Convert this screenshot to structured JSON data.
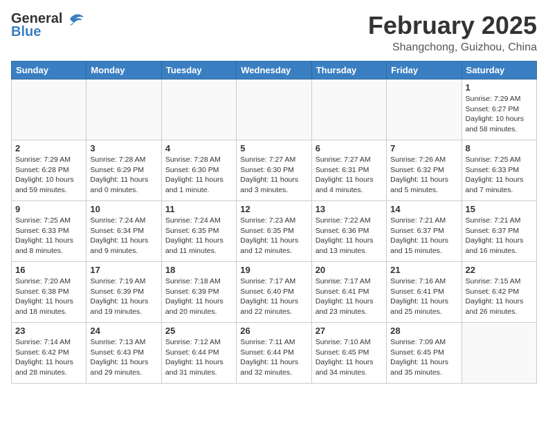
{
  "header": {
    "logo": {
      "general": "General",
      "blue": "Blue"
    },
    "title": "February 2025",
    "location": "Shangchong, Guizhou, China"
  },
  "calendar": {
    "days_of_week": [
      "Sunday",
      "Monday",
      "Tuesday",
      "Wednesday",
      "Thursday",
      "Friday",
      "Saturday"
    ],
    "weeks": [
      [
        {
          "day": "",
          "info": ""
        },
        {
          "day": "",
          "info": ""
        },
        {
          "day": "",
          "info": ""
        },
        {
          "day": "",
          "info": ""
        },
        {
          "day": "",
          "info": ""
        },
        {
          "day": "",
          "info": ""
        },
        {
          "day": "1",
          "info": "Sunrise: 7:29 AM\nSunset: 6:27 PM\nDaylight: 10 hours and 58 minutes."
        }
      ],
      [
        {
          "day": "2",
          "info": "Sunrise: 7:29 AM\nSunset: 6:28 PM\nDaylight: 10 hours and 59 minutes."
        },
        {
          "day": "3",
          "info": "Sunrise: 7:28 AM\nSunset: 6:29 PM\nDaylight: 11 hours and 0 minutes."
        },
        {
          "day": "4",
          "info": "Sunrise: 7:28 AM\nSunset: 6:30 PM\nDaylight: 11 hours and 1 minute."
        },
        {
          "day": "5",
          "info": "Sunrise: 7:27 AM\nSunset: 6:30 PM\nDaylight: 11 hours and 3 minutes."
        },
        {
          "day": "6",
          "info": "Sunrise: 7:27 AM\nSunset: 6:31 PM\nDaylight: 11 hours and 4 minutes."
        },
        {
          "day": "7",
          "info": "Sunrise: 7:26 AM\nSunset: 6:32 PM\nDaylight: 11 hours and 5 minutes."
        },
        {
          "day": "8",
          "info": "Sunrise: 7:25 AM\nSunset: 6:33 PM\nDaylight: 11 hours and 7 minutes."
        }
      ],
      [
        {
          "day": "9",
          "info": "Sunrise: 7:25 AM\nSunset: 6:33 PM\nDaylight: 11 hours and 8 minutes."
        },
        {
          "day": "10",
          "info": "Sunrise: 7:24 AM\nSunset: 6:34 PM\nDaylight: 11 hours and 9 minutes."
        },
        {
          "day": "11",
          "info": "Sunrise: 7:24 AM\nSunset: 6:35 PM\nDaylight: 11 hours and 11 minutes."
        },
        {
          "day": "12",
          "info": "Sunrise: 7:23 AM\nSunset: 6:35 PM\nDaylight: 11 hours and 12 minutes."
        },
        {
          "day": "13",
          "info": "Sunrise: 7:22 AM\nSunset: 6:36 PM\nDaylight: 11 hours and 13 minutes."
        },
        {
          "day": "14",
          "info": "Sunrise: 7:21 AM\nSunset: 6:37 PM\nDaylight: 11 hours and 15 minutes."
        },
        {
          "day": "15",
          "info": "Sunrise: 7:21 AM\nSunset: 6:37 PM\nDaylight: 11 hours and 16 minutes."
        }
      ],
      [
        {
          "day": "16",
          "info": "Sunrise: 7:20 AM\nSunset: 6:38 PM\nDaylight: 11 hours and 18 minutes."
        },
        {
          "day": "17",
          "info": "Sunrise: 7:19 AM\nSunset: 6:39 PM\nDaylight: 11 hours and 19 minutes."
        },
        {
          "day": "18",
          "info": "Sunrise: 7:18 AM\nSunset: 6:39 PM\nDaylight: 11 hours and 20 minutes."
        },
        {
          "day": "19",
          "info": "Sunrise: 7:17 AM\nSunset: 6:40 PM\nDaylight: 11 hours and 22 minutes."
        },
        {
          "day": "20",
          "info": "Sunrise: 7:17 AM\nSunset: 6:41 PM\nDaylight: 11 hours and 23 minutes."
        },
        {
          "day": "21",
          "info": "Sunrise: 7:16 AM\nSunset: 6:41 PM\nDaylight: 11 hours and 25 minutes."
        },
        {
          "day": "22",
          "info": "Sunrise: 7:15 AM\nSunset: 6:42 PM\nDaylight: 11 hours and 26 minutes."
        }
      ],
      [
        {
          "day": "23",
          "info": "Sunrise: 7:14 AM\nSunset: 6:42 PM\nDaylight: 11 hours and 28 minutes."
        },
        {
          "day": "24",
          "info": "Sunrise: 7:13 AM\nSunset: 6:43 PM\nDaylight: 11 hours and 29 minutes."
        },
        {
          "day": "25",
          "info": "Sunrise: 7:12 AM\nSunset: 6:44 PM\nDaylight: 11 hours and 31 minutes."
        },
        {
          "day": "26",
          "info": "Sunrise: 7:11 AM\nSunset: 6:44 PM\nDaylight: 11 hours and 32 minutes."
        },
        {
          "day": "27",
          "info": "Sunrise: 7:10 AM\nSunset: 6:45 PM\nDaylight: 11 hours and 34 minutes."
        },
        {
          "day": "28",
          "info": "Sunrise: 7:09 AM\nSunset: 6:45 PM\nDaylight: 11 hours and 35 minutes."
        },
        {
          "day": "",
          "info": ""
        }
      ]
    ]
  }
}
